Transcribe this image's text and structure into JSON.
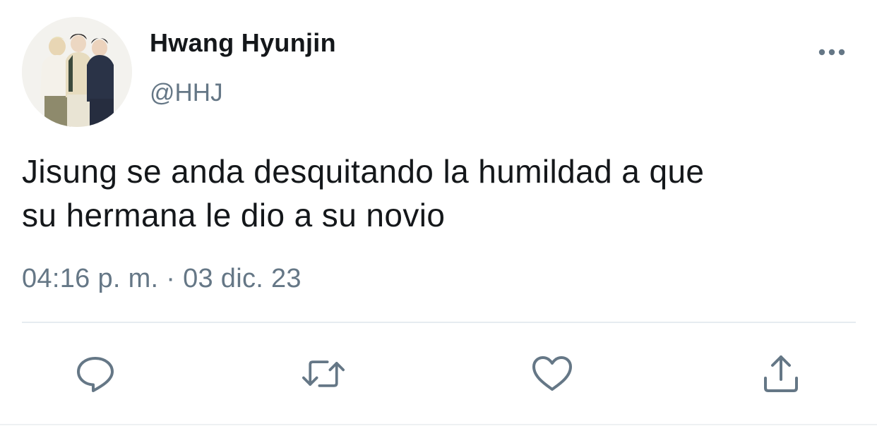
{
  "author": {
    "display_name": "Hwang Hyunjin",
    "handle": "@HHJ",
    "avatar_icon": "profile-photo"
  },
  "tweet": {
    "text_lines": [
      "Jisung se anda desquitando la humildad a que",
      "su hermana le dio a su novio"
    ],
    "timestamp": "04:16 p. m. · 03 dic. 23"
  },
  "actions": [
    {
      "name": "reply",
      "icon": "speech-bubble-icon"
    },
    {
      "name": "retweet",
      "icon": "retweet-arrows-icon"
    },
    {
      "name": "like",
      "icon": "heart-icon"
    },
    {
      "name": "share",
      "icon": "share-upload-icon"
    }
  ],
  "colors": {
    "text_primary": "#14171a",
    "text_secondary": "#657786",
    "icon": "#657786",
    "divider": "#e6ecf0"
  }
}
